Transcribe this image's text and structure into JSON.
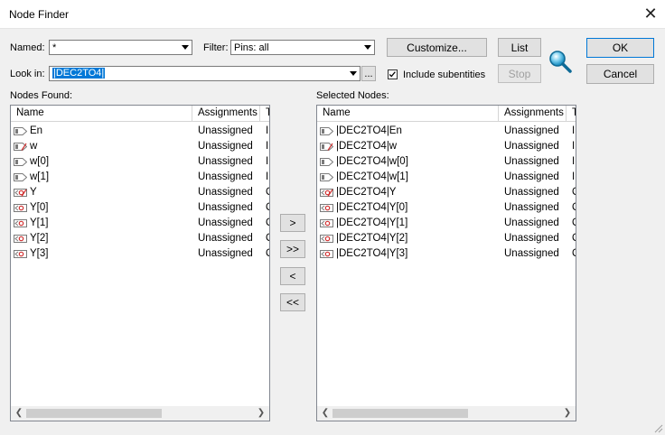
{
  "window": {
    "title": "Node Finder",
    "close_glyph": "✕"
  },
  "named": {
    "label": "Named:",
    "value": "*"
  },
  "filter": {
    "label": "Filter:",
    "value": "Pins: all"
  },
  "look_in": {
    "label": "Look in:",
    "value": "|DEC2TO4|",
    "browse_label": "..."
  },
  "include_subentities": {
    "label": "Include subentities",
    "checked": true
  },
  "buttons": {
    "customize": "Customize...",
    "list": "List",
    "stop": "Stop",
    "ok": "OK",
    "cancel": "Cancel"
  },
  "move_buttons": {
    "add": ">",
    "add_all": ">>",
    "remove": "<",
    "remove_all": "<<"
  },
  "nodes_found": {
    "label": "Nodes Found:",
    "columns": [
      "Name",
      "Assignments",
      "T"
    ],
    "rows": [
      {
        "name": "En",
        "assign": "Unassigned",
        "type": "I",
        "dir": "input"
      },
      {
        "name": "w",
        "assign": "Unassigned",
        "type": "I",
        "dir": "input-bus"
      },
      {
        "name": "w[0]",
        "assign": "Unassigned",
        "type": "I",
        "dir": "input"
      },
      {
        "name": "w[1]",
        "assign": "Unassigned",
        "type": "I",
        "dir": "input"
      },
      {
        "name": "Y",
        "assign": "Unassigned",
        "type": "O",
        "dir": "output-bus"
      },
      {
        "name": "Y[0]",
        "assign": "Unassigned",
        "type": "O",
        "dir": "output"
      },
      {
        "name": "Y[1]",
        "assign": "Unassigned",
        "type": "O",
        "dir": "output"
      },
      {
        "name": "Y[2]",
        "assign": "Unassigned",
        "type": "O",
        "dir": "output"
      },
      {
        "name": "Y[3]",
        "assign": "Unassigned",
        "type": "O",
        "dir": "output"
      }
    ]
  },
  "selected_nodes": {
    "label": "Selected Nodes:",
    "columns": [
      "Name",
      "Assignments",
      "T"
    ],
    "rows": [
      {
        "name": "|DEC2TO4|En",
        "assign": "Unassigned",
        "type": "I",
        "dir": "input"
      },
      {
        "name": "|DEC2TO4|w",
        "assign": "Unassigned",
        "type": "I",
        "dir": "input-bus"
      },
      {
        "name": "|DEC2TO4|w[0]",
        "assign": "Unassigned",
        "type": "I",
        "dir": "input"
      },
      {
        "name": "|DEC2TO4|w[1]",
        "assign": "Unassigned",
        "type": "I",
        "dir": "input"
      },
      {
        "name": "|DEC2TO4|Y",
        "assign": "Unassigned",
        "type": "O",
        "dir": "output-bus"
      },
      {
        "name": "|DEC2TO4|Y[0]",
        "assign": "Unassigned",
        "type": "O",
        "dir": "output"
      },
      {
        "name": "|DEC2TO4|Y[1]",
        "assign": "Unassigned",
        "type": "O",
        "dir": "output"
      },
      {
        "name": "|DEC2TO4|Y[2]",
        "assign": "Unassigned",
        "type": "O",
        "dir": "output"
      },
      {
        "name": "|DEC2TO4|Y[3]",
        "assign": "Unassigned",
        "type": "O",
        "dir": "output"
      }
    ]
  },
  "icons": {
    "search": "magnifier-icon",
    "input": "input-pin-icon",
    "output": "output-pin-icon"
  },
  "colors": {
    "accent": "#0078d7",
    "pin_gray": "#7a7a7a",
    "pin_red": "#d03030"
  }
}
